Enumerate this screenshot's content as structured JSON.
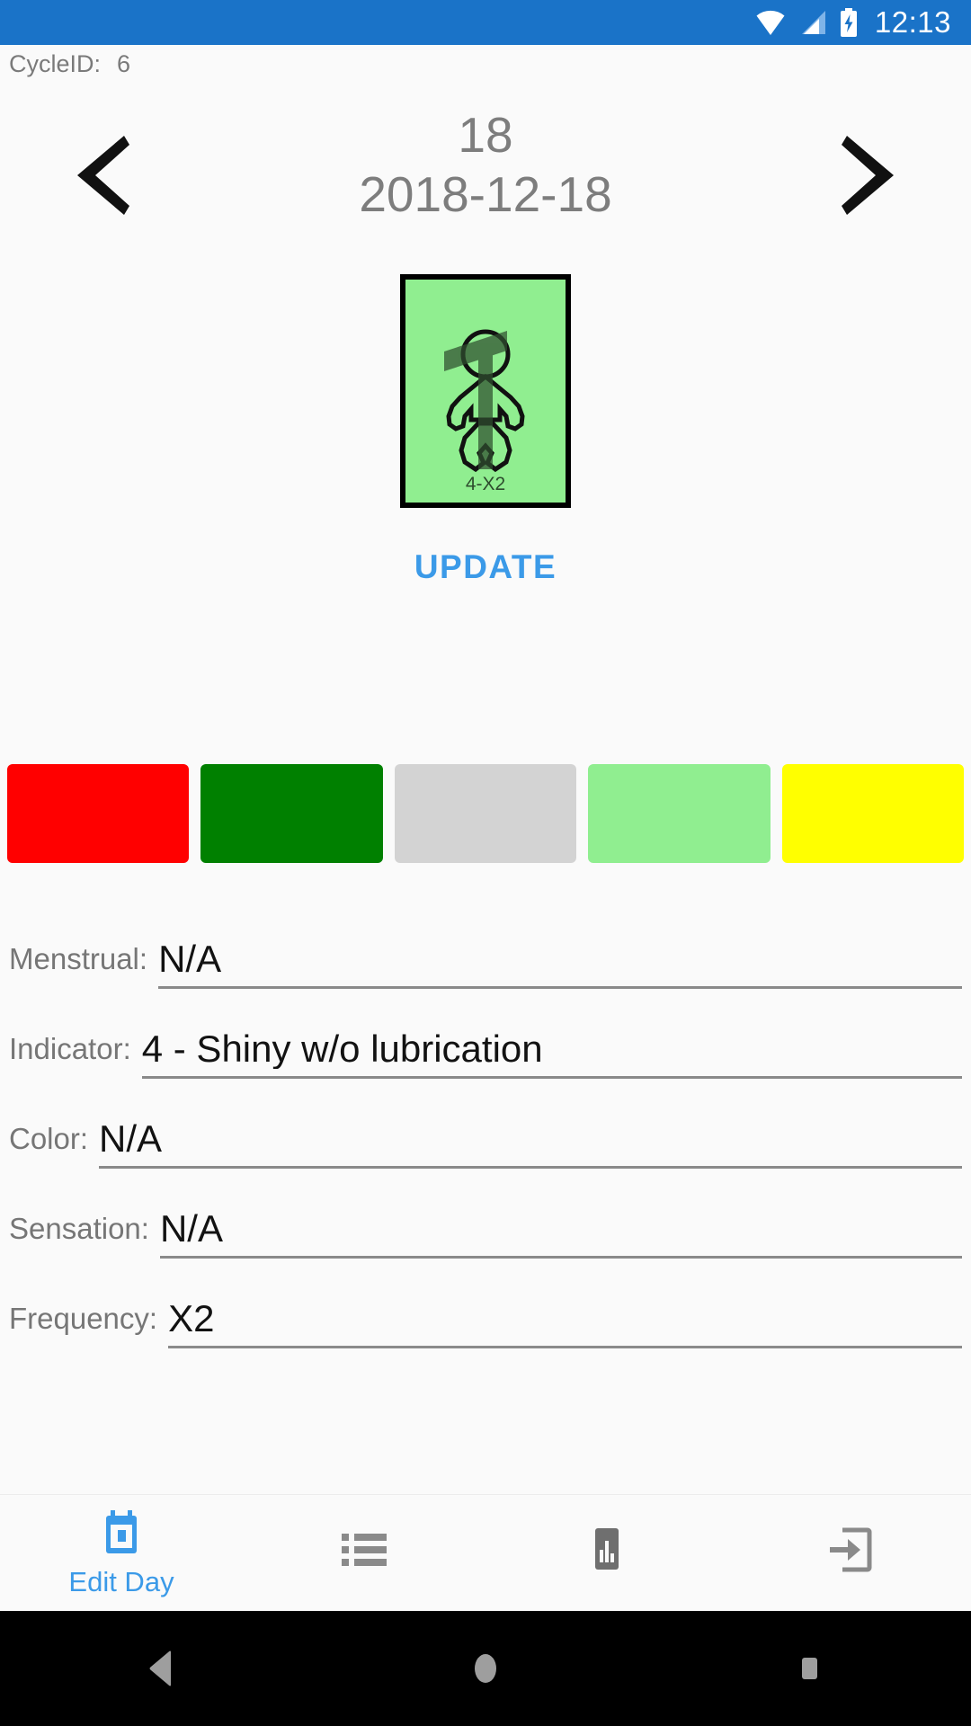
{
  "statusbar": {
    "time": "12:13",
    "wifi_icon": "wifi-icon",
    "signal_icon": "cell-signal-icon",
    "battery_icon": "battery-charging-icon",
    "background": "#1a73c8"
  },
  "cycle": {
    "label": "CycleID:",
    "value": "6"
  },
  "date_header": {
    "prev_icon": "chevron-left-icon",
    "next_icon": "chevron-right-icon",
    "day_number": "18",
    "date": "2018-12-18"
  },
  "day_card": {
    "label": "4-X2",
    "background": "#90ee90",
    "border_color": "#000000",
    "figure_icon": "baby-figure-icon"
  },
  "update": {
    "label": "UPDATE",
    "color": "#3b9ae8"
  },
  "swatches": [
    {
      "name": "swatch-red",
      "color": "#ff0000"
    },
    {
      "name": "swatch-dark-green",
      "color": "#008000"
    },
    {
      "name": "swatch-gray",
      "color": "#d3d3d3"
    },
    {
      "name": "swatch-light-green",
      "color": "#90ee90"
    },
    {
      "name": "swatch-yellow",
      "color": "#ffff00"
    }
  ],
  "fields": [
    {
      "label": "Menstrual:",
      "value": "N/A"
    },
    {
      "label": "Indicator:",
      "value": "4 - Shiny w/o lubrication"
    },
    {
      "label": "Color:",
      "value": "N/A"
    },
    {
      "label": "Sensation:",
      "value": "N/A"
    },
    {
      "label": "Frequency:",
      "value": "X2"
    }
  ],
  "bottom_nav": [
    {
      "label": "Edit Day",
      "icon": "calendar-icon",
      "active": true
    },
    {
      "label": "",
      "icon": "list-icon",
      "active": false
    },
    {
      "label": "",
      "icon": "bar-chart-icon",
      "active": false
    },
    {
      "label": "",
      "icon": "exit-icon",
      "active": false
    }
  ],
  "system_nav": {
    "back_icon": "back-triangle-icon",
    "home_icon": "home-circle-icon",
    "recents_icon": "recents-square-icon"
  }
}
